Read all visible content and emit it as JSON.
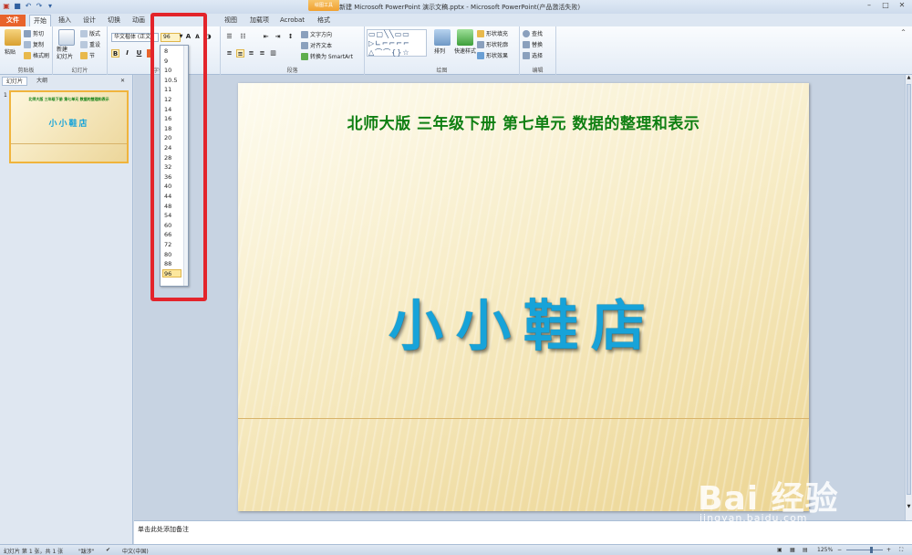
{
  "window": {
    "title": "新建 Microsoft PowerPoint 演示文稿.pptx - Microsoft PowerPoint(产品激活失败)",
    "context_tab": "绘图工具"
  },
  "tabs": [
    {
      "label": "文件"
    },
    {
      "label": "开始"
    },
    {
      "label": "插入"
    },
    {
      "label": "设计"
    },
    {
      "label": "切换"
    },
    {
      "label": "动画"
    },
    {
      "label": "视图"
    },
    {
      "label": "加载项"
    },
    {
      "label": "Acrobat"
    },
    {
      "label": "格式"
    }
  ],
  "ribbon": {
    "clipboard": {
      "label": "剪贴板",
      "paste": "粘贴",
      "cut": "剪切",
      "copy": "复制",
      "format_painter": "格式刷"
    },
    "slides": {
      "label": "幻灯片",
      "new_slide": "新建\n幻灯片",
      "layout": "版式",
      "reset": "重设",
      "section": "节"
    },
    "font": {
      "label": "字体",
      "font_name": "华文楷体 (正文",
      "font_size": "96",
      "bold": "B",
      "italic": "I",
      "underline": "U"
    },
    "paragraph": {
      "label": "段落",
      "text_direction": "文字方向",
      "align_text": "对齐文本",
      "smartart": "转换为 SmartArt"
    },
    "drawing": {
      "label": "绘图",
      "arrange": "排列",
      "quick_styles": "快速样式",
      "shape_fill": "形状填充",
      "shape_outline": "形状轮廓",
      "shape_effects": "形状效果"
    },
    "editing": {
      "label": "编辑",
      "find": "查找",
      "replace": "替换",
      "select": "选择"
    }
  },
  "font_size_options": [
    "8",
    "9",
    "10",
    "10.5",
    "11",
    "12",
    "14",
    "16",
    "18",
    "20",
    "24",
    "28",
    "32",
    "36",
    "40",
    "44",
    "48",
    "54",
    "60",
    "66",
    "72",
    "80",
    "88",
    "96"
  ],
  "font_size_selected": "96",
  "left_panel": {
    "tab_slides": "幻灯片",
    "tab_outline": "大纲",
    "thumb_number": "1",
    "thumb_heading": "北师大版 三年级下册 第七单元 数据的整理和表示",
    "thumb_title": "小小鞋店"
  },
  "slide": {
    "heading": "北师大版  三年级下册  第七单元  数据的整理和表示",
    "title": "小小鞋店"
  },
  "notes_placeholder": "单击此处添加备注",
  "status_bar": {
    "slide_info": "幻灯片 第 1 张，共 1 张",
    "theme": "\"跋涉\"",
    "language": "中文(中国)",
    "zoom": "125%"
  },
  "watermark": {
    "brand": "Bai 经验",
    "url": "jingyan.baidu.com"
  },
  "colors": {
    "file_tab": "#e8632b",
    "slide_heading": "#0f7f12",
    "slide_title": "#17a3d9",
    "highlight_box": "#e3242b"
  }
}
